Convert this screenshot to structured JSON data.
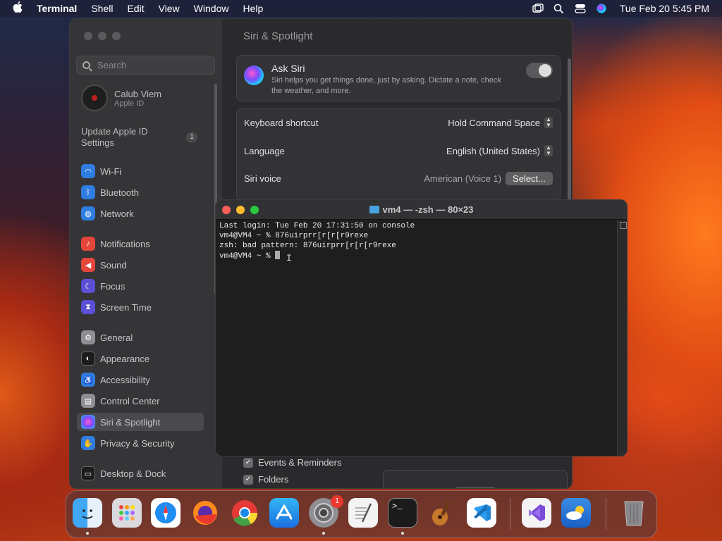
{
  "menubar": {
    "app": "Terminal",
    "items": [
      "Shell",
      "Edit",
      "View",
      "Window",
      "Help"
    ],
    "clock": "Tue Feb 20  5:45 PM"
  },
  "settings": {
    "title": "Siri & Spotlight",
    "search_placeholder": "Search",
    "profile": {
      "name": "Calub Viem",
      "sub": "Apple ID"
    },
    "update_notice": "Update Apple ID Settings",
    "update_badge": "1",
    "sidebar": [
      {
        "label": "Wi-Fi",
        "icon": "wifi-icon",
        "color": "#2f7de1"
      },
      {
        "label": "Bluetooth",
        "icon": "bluetooth-icon",
        "color": "#2f7de1"
      },
      {
        "label": "Network",
        "icon": "globe-icon",
        "color": "#2f7de1"
      },
      {
        "label": "Notifications",
        "icon": "bell-icon",
        "color": "#e5463c"
      },
      {
        "label": "Sound",
        "icon": "speaker-icon",
        "color": "#e5463c"
      },
      {
        "label": "Focus",
        "icon": "moon-icon",
        "color": "#5b4fd6"
      },
      {
        "label": "Screen Time",
        "icon": "hourglass-icon",
        "color": "#5b4fd6"
      },
      {
        "label": "General",
        "icon": "gear-icon",
        "color": "#8e8e93"
      },
      {
        "label": "Appearance",
        "icon": "appearance-icon",
        "color": "#1c1c1e"
      },
      {
        "label": "Accessibility",
        "icon": "accessibility-icon",
        "color": "#2f7de1"
      },
      {
        "label": "Control Center",
        "icon": "control-center-icon",
        "color": "#8e8e93"
      },
      {
        "label": "Siri & Spotlight",
        "icon": "siri-icon",
        "color": "#b04fd6"
      },
      {
        "label": "Privacy & Security",
        "icon": "hand-icon",
        "color": "#2f7de1"
      },
      {
        "label": "Desktop & Dock",
        "icon": "dock-icon",
        "color": "#1c1c1e"
      }
    ],
    "ask_siri": {
      "title": "Ask Siri",
      "description": "Siri helps you get things done, just by asking. Dictate a note, check the weather, and more.",
      "enabled": true
    },
    "rows": [
      {
        "label": "Keyboard shortcut",
        "value": "Hold Command Space"
      },
      {
        "label": "Language",
        "value": "English (United States)"
      },
      {
        "label": "Siri voice",
        "value": "American (Voice 1)",
        "button": "Select..."
      }
    ],
    "checkboxes": [
      {
        "label": "Events & Reminders",
        "checked": true
      },
      {
        "label": "Folders",
        "checked": true
      }
    ]
  },
  "terminal": {
    "title": "vm4 — -zsh — 80×23",
    "lines": [
      "Last login: Tue Feb 20 17:31:50 on console",
      "vm4@VM4 ~ % 876uirprr[r[r[r9rexe",
      "zsh: bad pattern: 876uirprr[r[r[r9rexe",
      "vm4@VM4 ~ % "
    ]
  },
  "dock": [
    {
      "name": "Finder",
      "icon": "finder-icon"
    },
    {
      "name": "Launchpad",
      "icon": "launchpad-icon"
    },
    {
      "name": "Safari",
      "icon": "safari-icon"
    },
    {
      "name": "Firefox",
      "icon": "firefox-icon"
    },
    {
      "name": "Chrome",
      "icon": "chrome-icon"
    },
    {
      "name": "App Store",
      "icon": "app-store-icon"
    },
    {
      "name": "System Settings",
      "icon": "system-settings-icon",
      "badge": "1"
    },
    {
      "name": "TextEdit",
      "icon": "textedit-icon"
    },
    {
      "name": "Terminal",
      "icon": "terminal-icon"
    },
    {
      "name": "Instruments",
      "icon": "instruments-icon"
    },
    {
      "name": "Visual Studio Code",
      "icon": "vscode-icon"
    },
    {
      "name": "Visual Studio",
      "icon": "visual-studio-icon"
    },
    {
      "name": "Weather",
      "icon": "weather-icon"
    },
    {
      "name": "Trash",
      "icon": "trash-icon"
    }
  ]
}
